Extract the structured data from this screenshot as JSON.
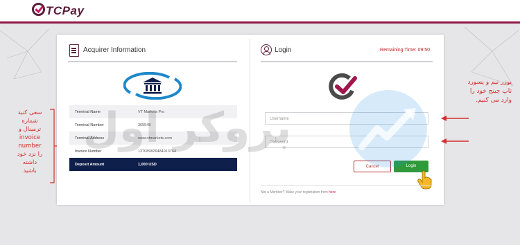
{
  "brand": {
    "logo": "TCPay"
  },
  "acquirer": {
    "title": "Acquirer Information",
    "rows": [
      {
        "label": "Terminal Name",
        "value": "VT Markets Pro"
      },
      {
        "label": "Terminal Number",
        "value": "365548"
      },
      {
        "label": "Terminal Address",
        "value": "www.vtmarkets.com"
      },
      {
        "label": "Invoice Number",
        "value": "137089826484913764"
      },
      {
        "label": "Deposit Amount",
        "value": "1,000 USD"
      }
    ]
  },
  "login": {
    "title": "Login",
    "remaining": "Remaining Time:  09:50",
    "username_placeholder": "Username",
    "password_placeholder": "Password",
    "cancel_label": "Cancel",
    "login_label": "Login",
    "footer_text": "Not a Member? Make your registration from ",
    "footer_link": "here"
  },
  "annotations": {
    "right_note_line1": "یوزر نیم و پسورد",
    "right_note_line2": "تاپ چینج خود را",
    "right_note_line3": "وارد می کنیم.",
    "left_note": [
      "سعی کنید",
      "شماره",
      "ترمینال و",
      "invoice",
      "number",
      "را نزد خود",
      "داشته",
      "باشید"
    ]
  },
  "watermark": {
    "text": "بروکر اول"
  },
  "colors": {
    "brand": "#5a1f3a",
    "accent": "#8e1746",
    "deposit_row": "#0f1f4b",
    "login_button": "#2f9a3a",
    "note": "#d32f2f"
  }
}
